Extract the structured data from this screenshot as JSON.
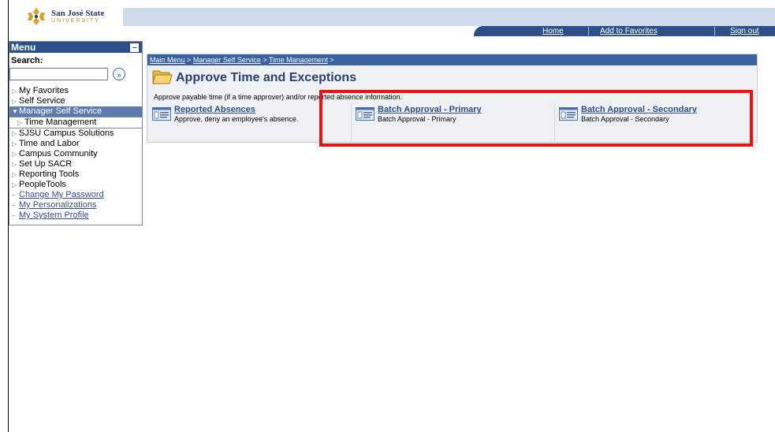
{
  "header": {
    "logo_name": "San José State",
    "logo_sub": "UNIVERSITY",
    "nav": {
      "home": "Home",
      "favorites": "Add to Favorites",
      "signout": "Sign out"
    }
  },
  "menu": {
    "title": "Menu",
    "search_label": "Search:",
    "search_value": "",
    "search_go": "»",
    "items": [
      {
        "label": "My Favorites"
      },
      {
        "label": "Self Service"
      },
      {
        "label": "Manager Self Service"
      },
      {
        "label": "Time Management"
      },
      {
        "label": "SJSU Campus Solutions"
      },
      {
        "label": "Time and Labor"
      },
      {
        "label": "Campus Community"
      },
      {
        "label": "Set Up SACR"
      },
      {
        "label": "Reporting Tools"
      },
      {
        "label": "PeopleTools"
      },
      {
        "label": "Change My Password"
      },
      {
        "label": "My Personalizations"
      },
      {
        "label": "My System Profile"
      }
    ]
  },
  "breadcrumb": {
    "main_menu": "Main Menu",
    "manager": "Manager Self Service",
    "time_mgmt": "Time Management",
    "sep": ">"
  },
  "page": {
    "title": "Approve Time and Exceptions",
    "instructions": "Approve payable time (if a time approver) and/or reported absence information."
  },
  "tiles": [
    {
      "title": "Reported Absences",
      "desc": "Approve, deny an employee's absence."
    },
    {
      "title": "Batch Approval - Primary",
      "desc": "Batch Approval - Primary"
    },
    {
      "title": "Batch Approval - Secondary",
      "desc": "Batch Approval - Secondary"
    }
  ],
  "colors": {
    "highlight": "#ee1111",
    "nav_bar": "#2c4f88",
    "breadcrumb": "#3a62a0",
    "menu_active": "#5d7bb0"
  }
}
